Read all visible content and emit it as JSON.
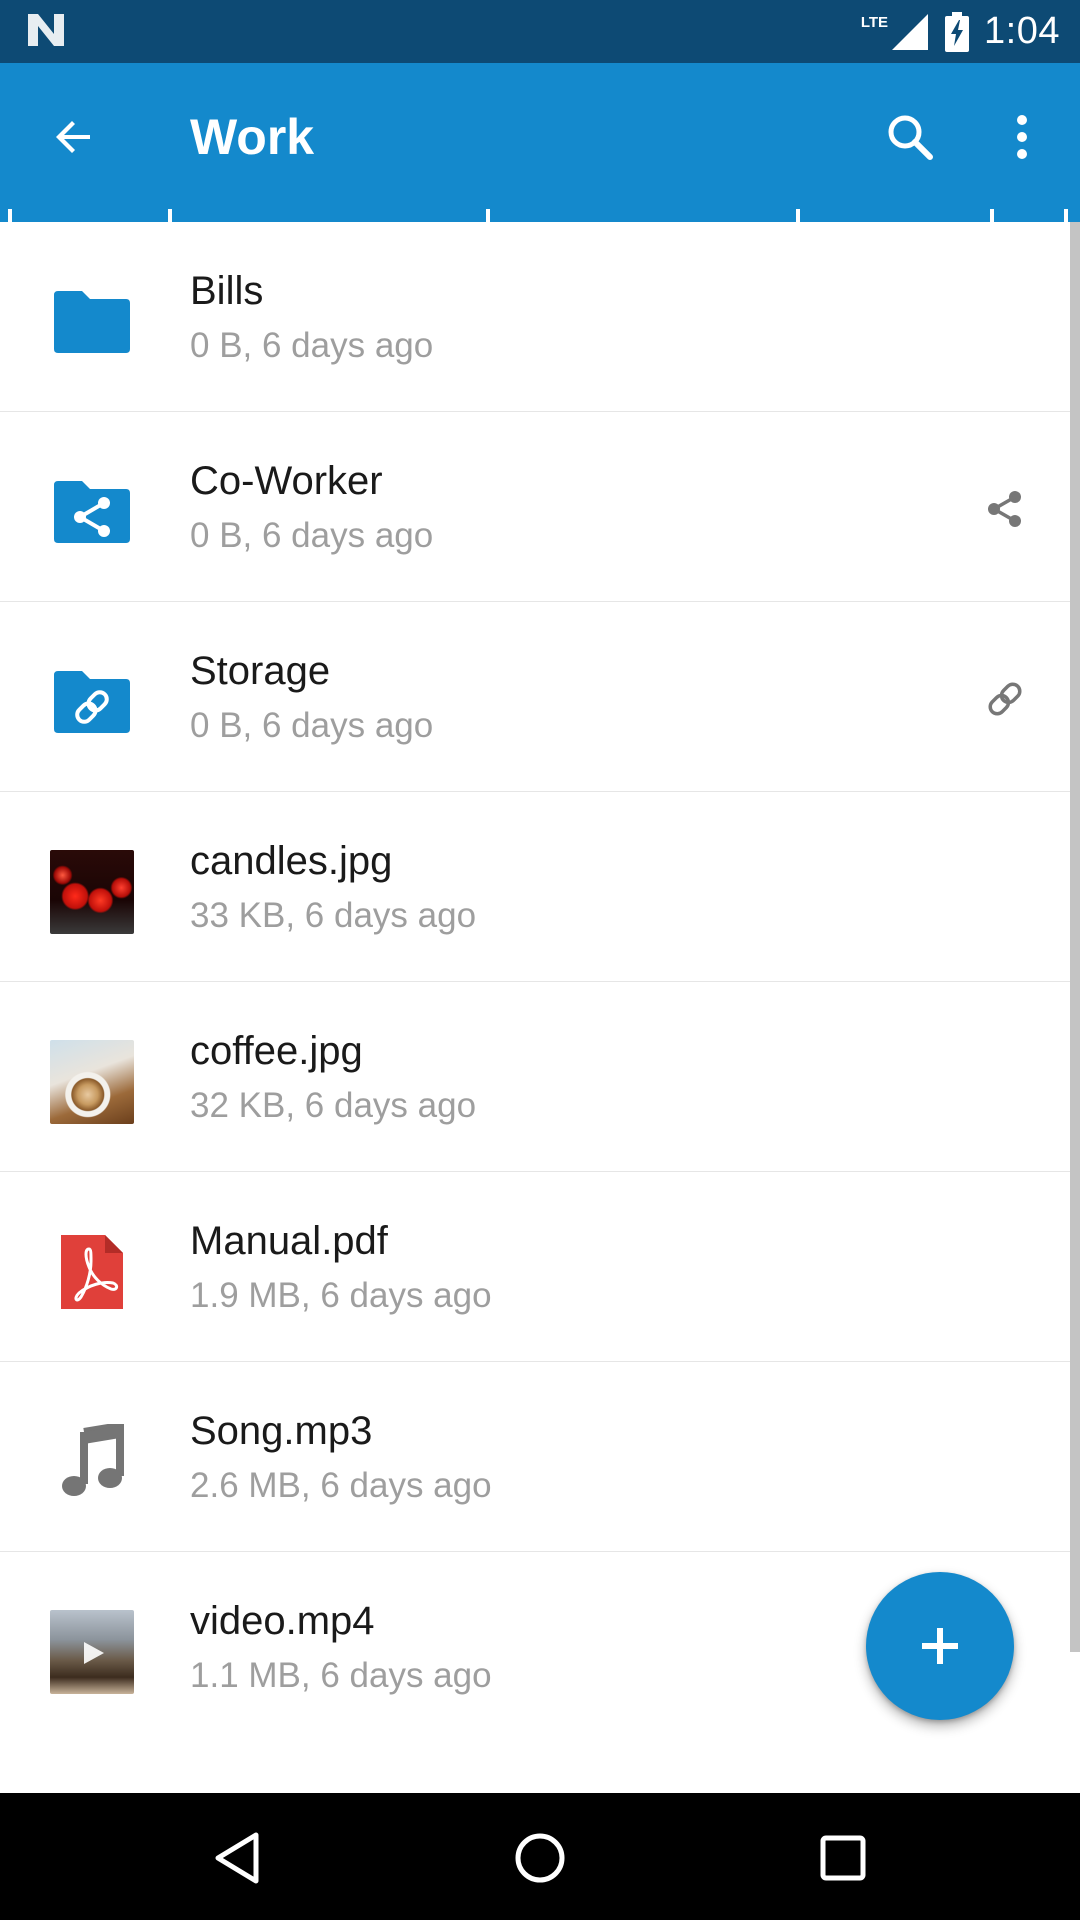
{
  "status_bar": {
    "network": "LTE",
    "time": "1:04"
  },
  "app_bar": {
    "title": "Work",
    "back_icon": "arrow-back-icon",
    "search_icon": "search-icon",
    "more_icon": "more-vert-icon"
  },
  "files": [
    {
      "name": "Bills",
      "meta": "0 B, 6 days ago",
      "icon": "folder-icon",
      "action": ""
    },
    {
      "name": "Co-Worker",
      "meta": "0 B, 6 days ago",
      "icon": "shared-folder-icon",
      "action": "share-icon"
    },
    {
      "name": "Storage",
      "meta": "0 B, 6 days ago",
      "icon": "linked-folder-icon",
      "action": "link-icon"
    },
    {
      "name": "candles.jpg",
      "meta": "33 KB, 6 days ago",
      "icon": "candles-thumbnail",
      "action": ""
    },
    {
      "name": "coffee.jpg",
      "meta": "32 KB, 6 days ago",
      "icon": "coffee-thumbnail",
      "action": ""
    },
    {
      "name": "Manual.pdf",
      "meta": "1.9 MB, 6 days ago",
      "icon": "pdf-icon",
      "action": ""
    },
    {
      "name": "Song.mp3",
      "meta": "2.6 MB, 6 days ago",
      "icon": "music-note-icon",
      "action": ""
    },
    {
      "name": "video.mp4",
      "meta": "1.1 MB, 6 days ago",
      "icon": "video-thumbnail",
      "action": ""
    }
  ],
  "fab": {
    "icon": "plus-icon"
  },
  "nav_bar": {
    "back": "nav-back-icon",
    "home": "nav-home-icon",
    "recents": "nav-recents-icon"
  },
  "colors": {
    "status_bar": "#0d4a74",
    "app_bar": "#1489cc",
    "accent": "#1489cc",
    "folder": "#1489cc",
    "pdf": "#e0403a",
    "secondary_text": "#9e9e9e"
  }
}
